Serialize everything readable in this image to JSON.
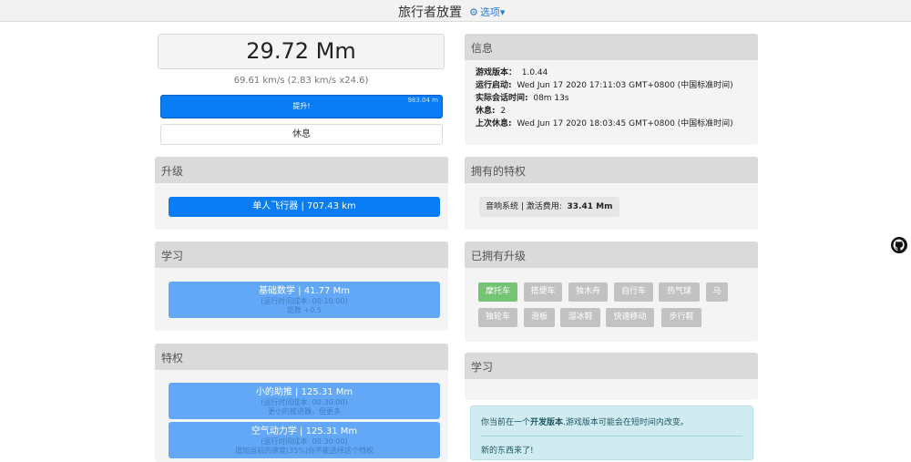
{
  "header": {
    "title": "旅行者放置",
    "options_label": "选项"
  },
  "distance": "29.72 Mm",
  "speed": "69.61 km/s (2.83 km/s x24.6)",
  "boost": {
    "label": "提升!",
    "corner_text": "983.04 m"
  },
  "rest_label": "休息",
  "upgrades_panel": {
    "title": "升级",
    "button": "单人飞行器 | 707.43 km"
  },
  "learn_panel": {
    "title": "学习",
    "item": {
      "title": "基础数学 | 41.77 Mm",
      "line1": "(运行时间成本: 00:10:00)",
      "line2": "距数 +0.5"
    }
  },
  "perks_panel": {
    "title": "特权",
    "items": [
      {
        "title": "小的助推 | 125.31 Mm",
        "line1": "(运行时间成本: 00:30:00)",
        "line2": "更小的推进器，但更多"
      },
      {
        "title": "空气动力学 | 125.31 Mm",
        "line1": "(运行时间成本: 00:30:00)",
        "line2": "增加当前的速度(35%)你不能选择这个特权"
      }
    ]
  },
  "info_panel": {
    "title": "信息",
    "rows": [
      {
        "label": "游戏版本：",
        "value": "1.0.44"
      },
      {
        "label": "运行启动:",
        "value": "Wed Jun 17 2020 17:11:03 GMT+0800 (中国标准时间)"
      },
      {
        "label": "实际会话时间:",
        "value": "08m 13s"
      },
      {
        "label": "休息:",
        "value": "2"
      },
      {
        "label": "上次休息:",
        "value": "Wed Jun 17 2020 18:03:45 GMT+0800 (中国标准时间)"
      }
    ]
  },
  "owned_perks_panel": {
    "title": "拥有的特权",
    "chip_label": "音响系统 | 激活费用:",
    "chip_value": "33.41 Mm"
  },
  "owned_upgrades_panel": {
    "title": "已拥有升级",
    "chips": [
      "摩托车",
      "搭便车",
      "独木舟",
      "自行车",
      "热气球",
      "马",
      "独轮车",
      "滑板",
      "溜冰鞋",
      "快速移动",
      "步行鞋"
    ]
  },
  "learn_panel_right": {
    "title": "学习"
  },
  "notice": {
    "text_before": "你当前在一个",
    "text_bold": "开发版本",
    "text_after": ".游戏版本可能会在短时间内改变。",
    "second": "新的东西来了!"
  }
}
